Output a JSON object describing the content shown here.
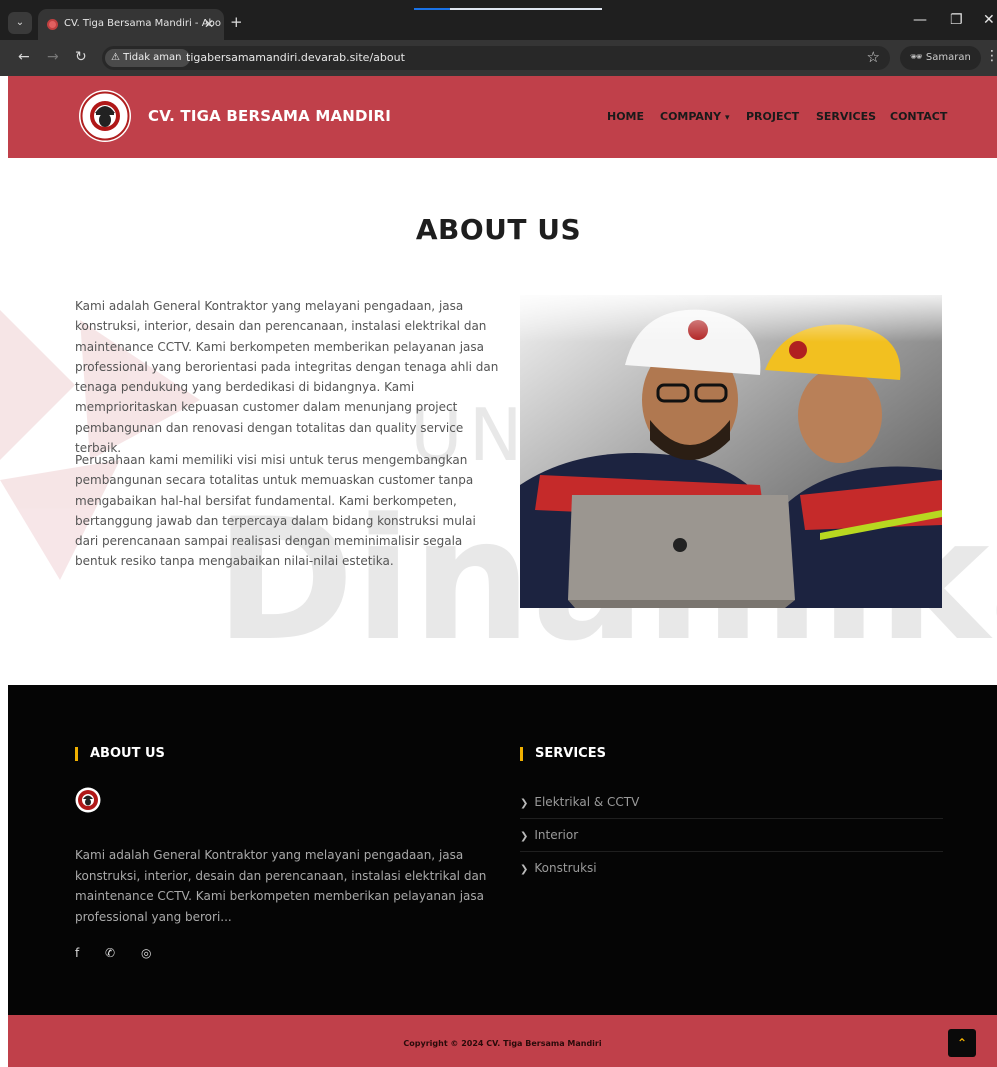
{
  "browser": {
    "tab_title": "CV. Tiga Bersama Mandiri - Abo",
    "tab_close": "✕",
    "new_tab": "+",
    "security_label": "Tidak aman",
    "url": "tigabersamamandiri.devarab.site/about",
    "profile_label": "Samaran",
    "win_minimize": "—",
    "win_restore": "❐",
    "win_close": "✕"
  },
  "header": {
    "brand": "CV. TIGA BERSAMA MANDIRI",
    "nav": {
      "home": "HOME",
      "company": "COMPANY",
      "project": "PROJECT",
      "services": "SERVICES",
      "contact": "CONTACT"
    },
    "logo_text": "TIGA BERSAMA MANDIRI"
  },
  "about": {
    "title": "ABOUT US",
    "paragraph_1": "Kami adalah General Kontraktor yang melayani pengadaan, jasa konstruksi, interior, desain dan perencanaan, instalasi elektrikal dan maintenance CCTV. Kami berkompeten memberikan pelayanan jasa professional yang berorientasi pada integritas dengan tenaga ahli dan tenaga pendukung yang berdedikasi di bidangnya. Kami memprioritaskan kepuasan customer dalam menunjang project pembangunan dan renovasi dengan totalitas dan quality service terbaik.",
    "paragraph_2": "Perusahaan kami memiliki visi misi untuk terus mengembangkan pembangunan secara totalitas untuk memuaskan customer tanpa mengabaikan hal-hal bersifat fundamental. Kami berkompeten, bertanggung jawab dan terpercaya dalam bidang konstruksi mulai dari perencanaan sampai realisasi dengan meminimalisir segala bentuk resiko tanpa mengabaikan nilai-nilai estetika."
  },
  "watermark": {
    "text_1": "UNIVERSITAS",
    "text_2": "Dinamika"
  },
  "footer": {
    "about_heading": "ABOUT US",
    "about_text": "Kami adalah General Kontraktor yang melayani pengadaan, jasa konstruksi, interior, desain dan perencanaan, instalasi elektrikal dan maintenance CCTV. Kami berkompeten memberikan pelayanan jasa professional yang berori...",
    "services_heading": "SERVICES",
    "services": [
      "Elektrikal & CCTV",
      "Interior",
      "Konstruksi"
    ],
    "social_icons": [
      "facebook-icon",
      "whatsapp-icon",
      "instagram-icon"
    ],
    "copyright": "Copyright © 2024 CV. Tiga Bersama Mandiri",
    "to_top": "⌃"
  },
  "colors": {
    "brand_red": "#c0404a",
    "accent_yellow": "#f0b000",
    "footer_bg": "#050505"
  }
}
